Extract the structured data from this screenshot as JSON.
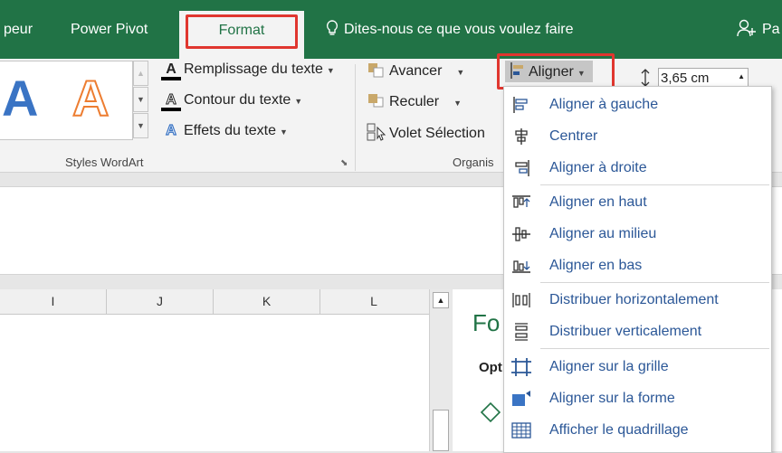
{
  "tabs": {
    "t1": "peur",
    "t2": "Power Pivot",
    "t3": "Format",
    "tell": "Dites-nous ce que vous voulez faire",
    "user": "Pa"
  },
  "wordart": {
    "letter": "A",
    "cmd1": "Remplissage du texte",
    "cmd2": "Contour du texte",
    "cmd3": "Effets du texte",
    "group": "Styles WordArt",
    "colors": {
      "blue": "#3a74c4",
      "orange": "#ed7d31"
    }
  },
  "arrange": {
    "cmd1": "Avancer",
    "cmd2": "Reculer",
    "cmd3": "Volet Sélection",
    "align": "Aligner",
    "group": "Organis"
  },
  "size": {
    "height": "3,65 cm"
  },
  "columns": [
    "I",
    "J",
    "K",
    "L"
  ],
  "pane": {
    "title": "Fo",
    "sub": "Opt"
  },
  "menu": {
    "items": [
      "Aligner à gauche",
      "Centrer",
      "Aligner à droite",
      "Aligner en haut",
      "Aligner au milieu",
      "Aligner en bas",
      "Distribuer horizontalement",
      "Distribuer verticalement",
      "Aligner sur la grille",
      "Aligner sur la forme",
      "Afficher le quadrillage"
    ]
  },
  "colors": {
    "excel_green": "#217346",
    "highlight": "#e0362f",
    "menu_text": "#2b5797"
  }
}
